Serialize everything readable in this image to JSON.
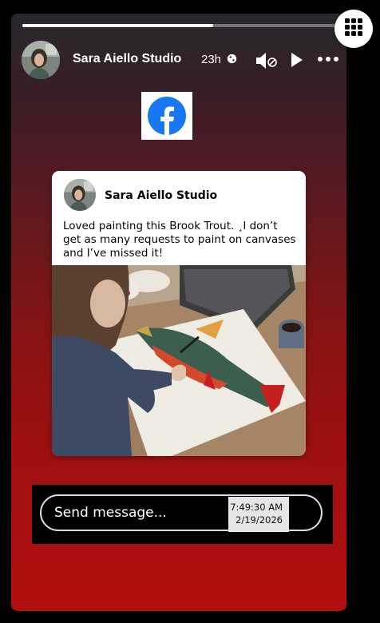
{
  "story": {
    "progress_fraction": 0.61,
    "author": "Sara Aiello Studio",
    "time": "23h",
    "icons": [
      "globe-icon",
      "mute-icon",
      "play-icon",
      "more-icon"
    ]
  },
  "logo": {
    "icon": "facebook-logo"
  },
  "post": {
    "author": "Sara Aiello Studio",
    "text": "Loved painting this Brook Trout. ¸I don’t get as many requests to paint on canvases and I’ve missed it!"
  },
  "reply": {
    "placeholder": "Send message...",
    "time": "7:49:30 AM",
    "date": "2/19/2026"
  },
  "menu": {
    "icon": "grid-icon"
  },
  "colors": {
    "facebook_blue": "#1877F2",
    "story_top": "#28282c",
    "story_bottom": "#b20f0f"
  }
}
